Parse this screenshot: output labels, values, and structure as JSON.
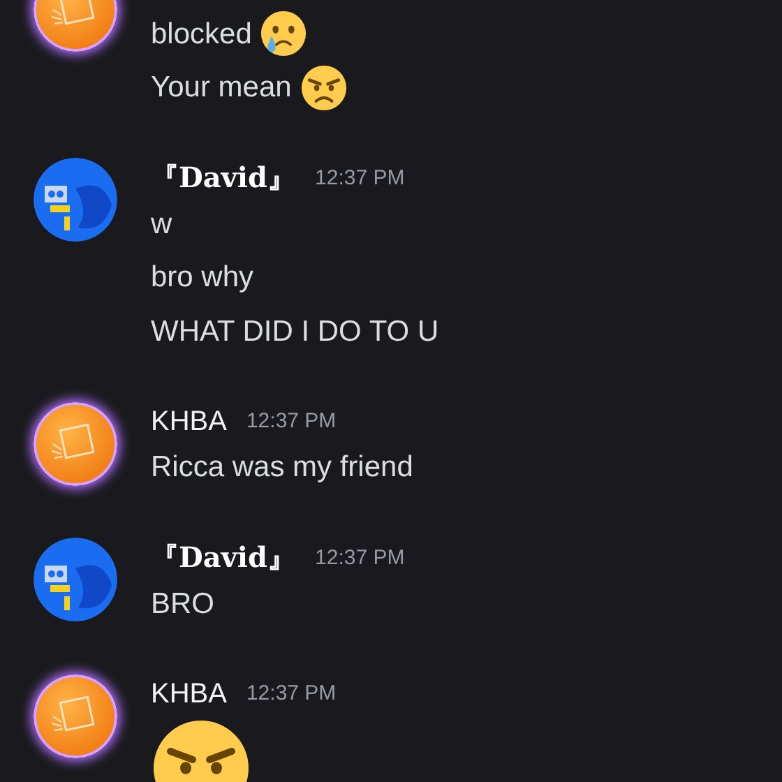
{
  "messages": [
    {
      "kind": "orange",
      "lines": [
        {
          "kind": "crying",
          "text": "blocked"
        },
        {
          "kind": "angry",
          "text": "Your mean"
        }
      ]
    },
    {
      "kind": "blue",
      "author": "『David』",
      "time": "12:37 PM",
      "lines": [
        {
          "kind": "plain",
          "text": "w"
        },
        {
          "kind": "plain",
          "text": "bro why"
        },
        {
          "kind": "plain",
          "text": "WHAT DID I DO TO U"
        }
      ]
    },
    {
      "kind": "orange",
      "author": "KHBA",
      "time": "12:37 PM",
      "lines": [
        {
          "kind": "plain",
          "text": "Ricca was my friend"
        }
      ]
    },
    {
      "kind": "blue",
      "author": "『David』",
      "time": "12:37 PM",
      "lines": [
        {
          "kind": "plain",
          "text": "BRO"
        }
      ]
    },
    {
      "kind": "orange",
      "author": "KHBA",
      "time": "12:37 PM",
      "lines": [
        {
          "kind": "jumbo"
        }
      ]
    }
  ]
}
